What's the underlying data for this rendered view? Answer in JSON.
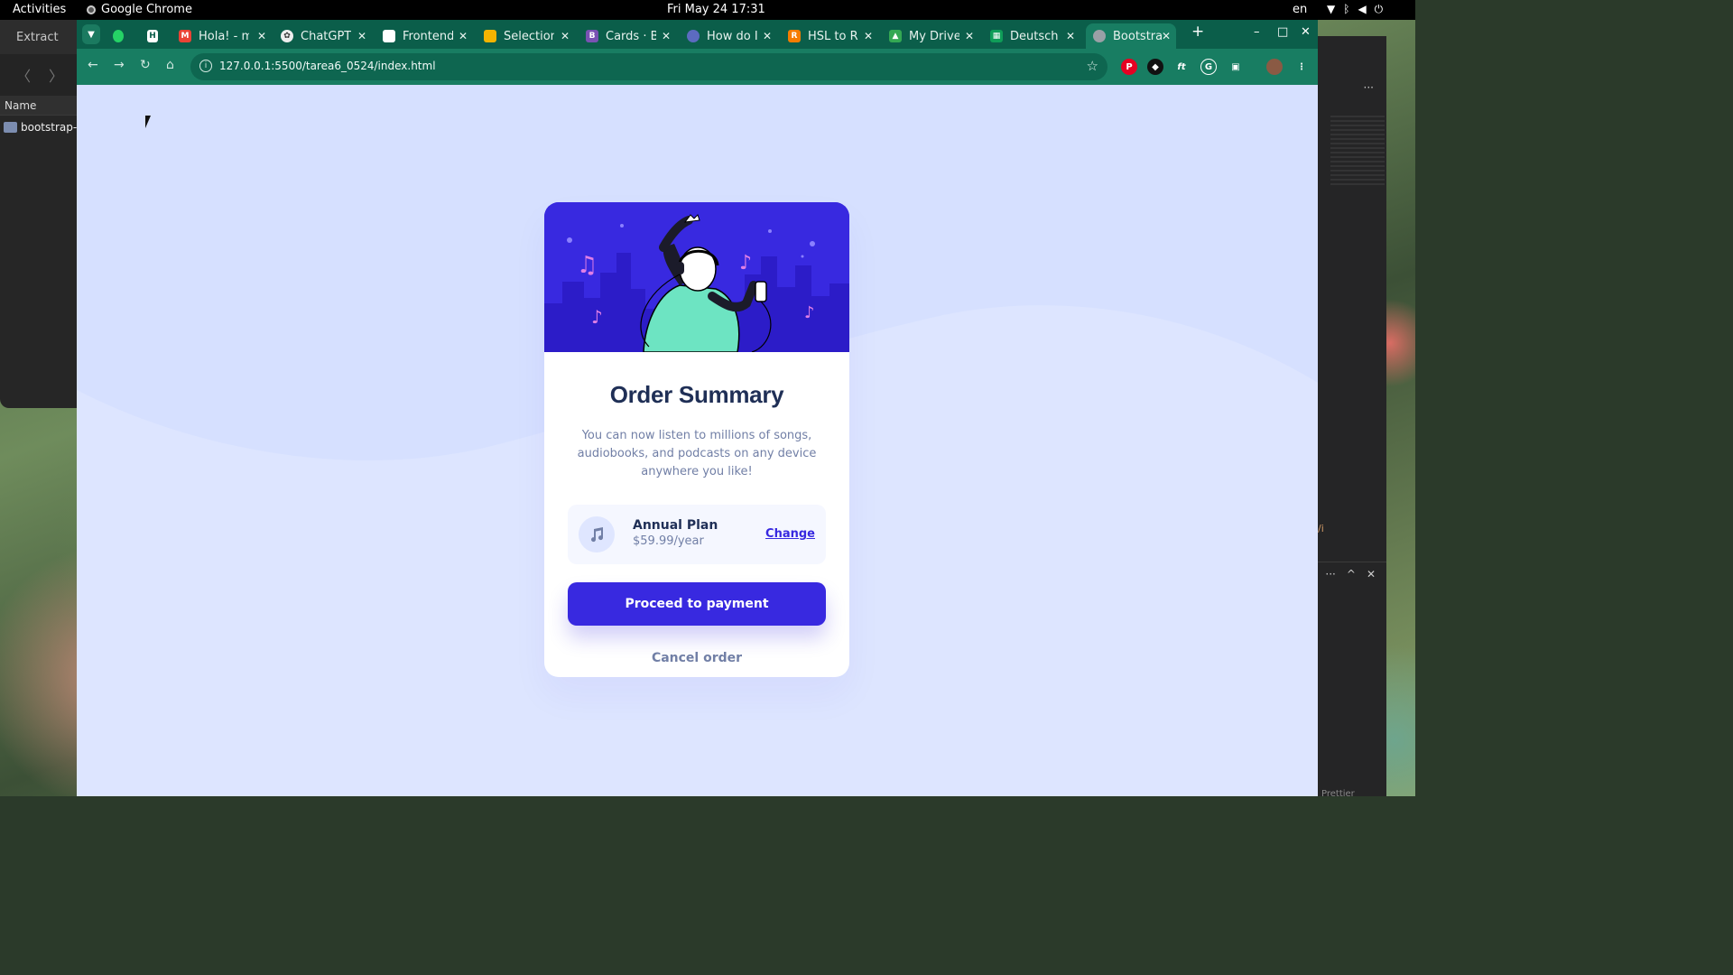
{
  "topbar": {
    "activities": "Activities",
    "app_name": "Google Chrome",
    "clock": "Fri May 24  17:31",
    "lang": "en"
  },
  "files_window": {
    "title": "Extract",
    "column_name": "Name",
    "items": [
      {
        "name": "bootstrap-s"
      }
    ]
  },
  "browser": {
    "tabs": [
      {
        "title": "",
        "icon": "whatsapp-icon",
        "color": "#25d366"
      },
      {
        "title": "",
        "icon": "hackmd-icon",
        "color": "#1f2b36"
      },
      {
        "title": "Hola! - mr",
        "icon": "gmail-icon",
        "color": "#ea4335"
      },
      {
        "title": "ChatGPT",
        "icon": "chatgpt-icon",
        "color": "#10a37f"
      },
      {
        "title": "Frontend",
        "icon": "frontendmentor-icon",
        "color": "#ffffff"
      },
      {
        "title": "Selection",
        "icon": "selection-icon",
        "color": "#f4b400"
      },
      {
        "title": "Cards · Bo",
        "icon": "bootstrap-icon",
        "color": "#7952b3"
      },
      {
        "title": "How do I",
        "icon": "web-icon",
        "color": "#5c6bc0"
      },
      {
        "title": "HSL to RG",
        "icon": "r-icon",
        "color": "#f57c00"
      },
      {
        "title": "My Drive",
        "icon": "google-drive-icon",
        "color": "#34a853"
      },
      {
        "title": "Deutsch -",
        "icon": "google-sheets-icon",
        "color": "#0f9d58"
      },
      {
        "title": "Bootstrap",
        "icon": "globe-icon",
        "color": "#9aa0a6"
      }
    ],
    "url": "127.0.0.1:5500/tarea6_0524/index.html"
  },
  "page": {
    "title": "Order Summary",
    "description": "You can now listen to millions of songs, audiobooks, and podcasts on any device anywhere you like!",
    "plan": {
      "name": "Annual Plan",
      "price": "$59.99/year",
      "change_label": "Change"
    },
    "proceed_label": "Proceed to payment",
    "cancel_label": "Cancel order",
    "colors": {
      "primary": "#3829e0",
      "background": "#e0e8ff",
      "heading": "#1f2f56",
      "muted": "#717fa6"
    }
  },
  "editor": {
    "link_text": "/i",
    "status": "Prettier"
  }
}
